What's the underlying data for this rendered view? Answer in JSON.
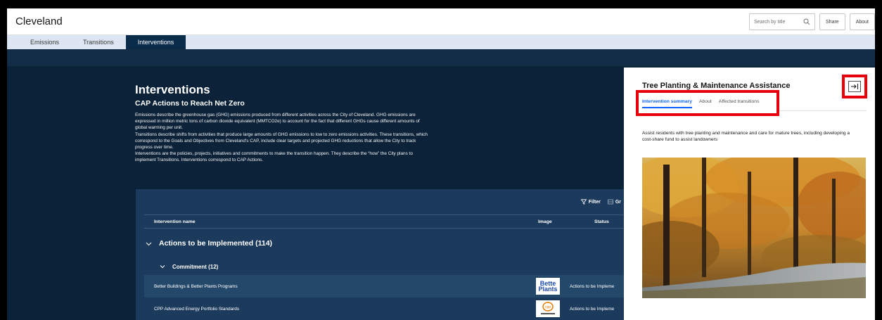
{
  "app": {
    "title": "Cleveland"
  },
  "header": {
    "search_placeholder": "Search by title",
    "share_label": "Share",
    "about_label": "About"
  },
  "tabs": [
    {
      "label": "Emissions",
      "active": false
    },
    {
      "label": "Transitions",
      "active": false
    },
    {
      "label": "Interventions",
      "active": true
    }
  ],
  "main": {
    "title": "Interventions",
    "subtitle": "CAP Actions to Reach Net Zero",
    "description_lines": [
      "Emissions describe the greenhouse gas (GHG) emissions produced from different activities across the City of Cleveland. GHG emissions are",
      "expressed in million metric tons of carbon dioxide equivalent (MMTCO2e) to account for the fact that different GHGs cause different amounts of",
      "global warming per unit.",
      "Transitions describe shifts from activities that produce large amounts of GHG emissions to low to zero emissions activities. These transitions, which",
      "correspond to the Goals and Objectives from Cleveland's CAP, include clear targets and projected GHG reductions that allow the City to track",
      "progress over time.",
      "Interventions are the policies, projects, initiatives and commitments to make the transition happen. They describe the “how” the City plans to",
      "implement Transitions. Interventions correspond to CAP Actions."
    ]
  },
  "table": {
    "toolbar": {
      "filter_label": "Filter",
      "group_label": "Gr"
    },
    "columns": {
      "name": "Intervention name",
      "image": "Image",
      "status": "Status"
    },
    "group": {
      "label": "Actions to be Implemented (114)"
    },
    "subgroup": {
      "label": "Commitment (12)"
    },
    "rows": [
      {
        "name": "Better Buildings & Better Plants Programs",
        "image_text": "Better Plants",
        "status": "Actions to be Impleme"
      },
      {
        "name": "CPP Advanced Energy Portfolio Standards",
        "image_text": "cpp",
        "status": "Actions to be Impleme"
      }
    ]
  },
  "side_panel": {
    "title": "Tree Planting & Maintenance Assistance",
    "tabs": [
      {
        "label": "Intervention summary",
        "active": true
      },
      {
        "label": "About",
        "active": false
      },
      {
        "label": "Affected transitions",
        "active": false
      }
    ],
    "summary": "Assist residents with tree planting and maintenance and care for mature trees, including developing a cost-share fund to assist landowners",
    "collapse_icon": "arrow-right-to-line-icon"
  },
  "colors": {
    "dark_bg": "#0b2239",
    "tab_active": "#0b2b4a",
    "tab_bar": "#dde6f2",
    "table_panel": "#1b3a5c",
    "accent": "#0f62fe",
    "highlight": "#e8000b"
  }
}
